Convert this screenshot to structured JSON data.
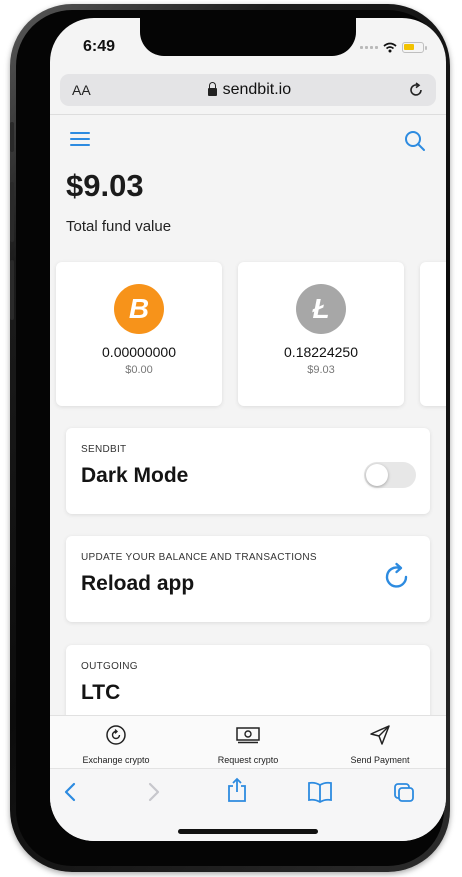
{
  "status_bar": {
    "time": "6:49"
  },
  "browser": {
    "text_size_label": "AA",
    "url": "sendbit.io"
  },
  "header": {
    "menu_icon": "hamburger-icon",
    "search_icon": "search-icon"
  },
  "balance": {
    "total": "$9.03",
    "label": "Total fund value"
  },
  "coins": [
    {
      "icon": "bitcoin-icon",
      "glyph": "B",
      "color": "#f7931a",
      "amount": "0.00000000",
      "fiat": "$0.00"
    },
    {
      "icon": "litecoin-icon",
      "glyph": "Ł",
      "color": "#a7a7a7",
      "amount": "0.18224250",
      "fiat": "$9.03"
    }
  ],
  "dark_mode_card": {
    "kicker": "SENDBIT",
    "title": "Dark Mode",
    "enabled": false
  },
  "reload_card": {
    "kicker": "UPDATE YOUR BALANCE AND TRANSACTIONS",
    "title": "Reload app"
  },
  "outgoing_card": {
    "kicker": "OUTGOING",
    "title": "LTC"
  },
  "tabs": [
    {
      "icon": "exchange-icon",
      "label": "Exchange crypto"
    },
    {
      "icon": "cash-icon",
      "label": "Request crypto"
    },
    {
      "icon": "send-icon",
      "label": "Send Payment"
    }
  ],
  "colors": {
    "accent": "#2d8be0",
    "bitcoin": "#f7931a",
    "litecoin": "#a7a7a7"
  }
}
